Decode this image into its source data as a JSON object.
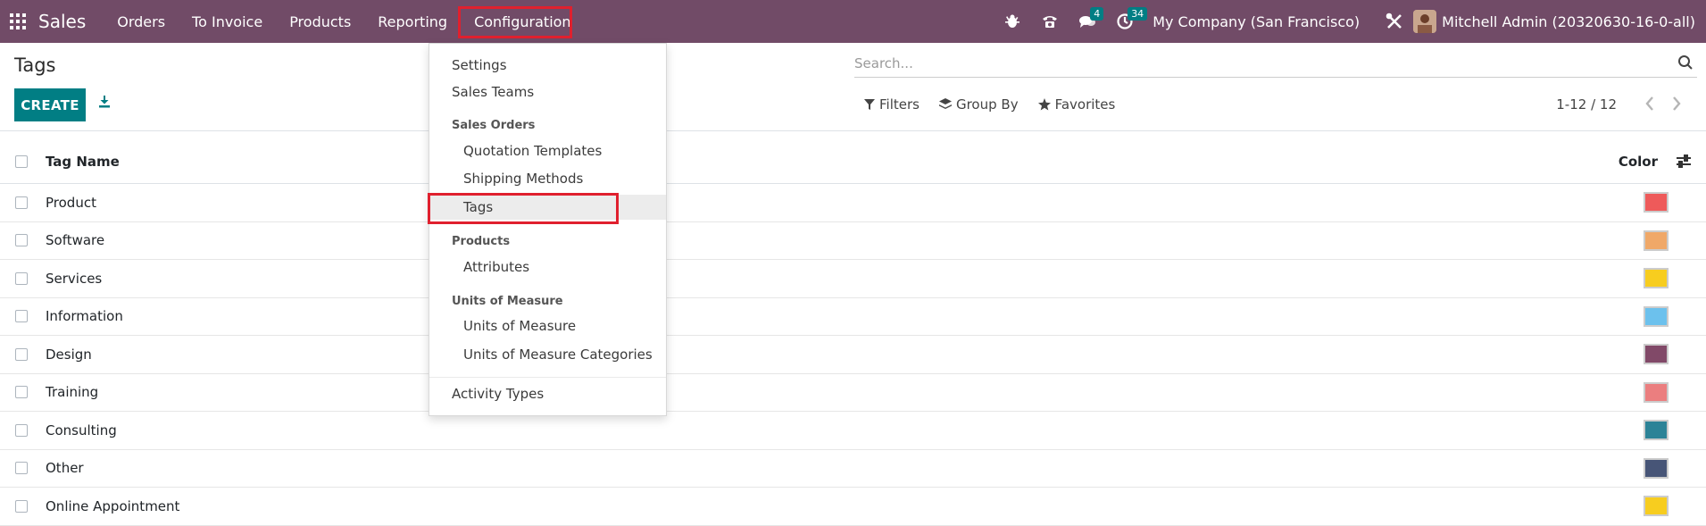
{
  "navbar": {
    "app_name": "Sales",
    "menu": [
      "Orders",
      "To Invoice",
      "Products",
      "Reporting",
      "Configuration"
    ],
    "messages_badge": "4",
    "activities_badge": "34",
    "company": "My Company (San Francisco)",
    "user": "Mitchell Admin (20320630-16-0-all)",
    "bg_color": "#714b67"
  },
  "page": {
    "title": "Tags",
    "create_label": "CREATE",
    "search_placeholder": "Search...",
    "filters_label": "Filters",
    "groupby_label": "Group By",
    "favorites_label": "Favorites",
    "pager": "1-12 / 12"
  },
  "table": {
    "col_name": "Tag Name",
    "col_color": "Color",
    "rows": [
      {
        "name": "Product",
        "color": "#ee5a5a"
      },
      {
        "name": "Software",
        "color": "#f0a868"
      },
      {
        "name": "Services",
        "color": "#f7cd1f"
      },
      {
        "name": "Information",
        "color": "#6cc1ed"
      },
      {
        "name": "Design",
        "color": "#814968"
      },
      {
        "name": "Training",
        "color": "#eb7e7f"
      },
      {
        "name": "Consulting",
        "color": "#2c8397"
      },
      {
        "name": "Other",
        "color": "#475577"
      },
      {
        "name": "Online Appointment",
        "color": "#f7cd1f"
      }
    ]
  },
  "dropdown": {
    "settings": "Settings",
    "sales_teams": "Sales Teams",
    "h_sales_orders": "Sales Orders",
    "quotation_templates": "Quotation Templates",
    "shipping_methods": "Shipping Methods",
    "tags": "Tags",
    "h_products": "Products",
    "attributes": "Attributes",
    "h_uom": "Units of Measure",
    "uom": "Units of Measure",
    "uom_categories": "Units of Measure Categories",
    "activity_types": "Activity Types"
  }
}
